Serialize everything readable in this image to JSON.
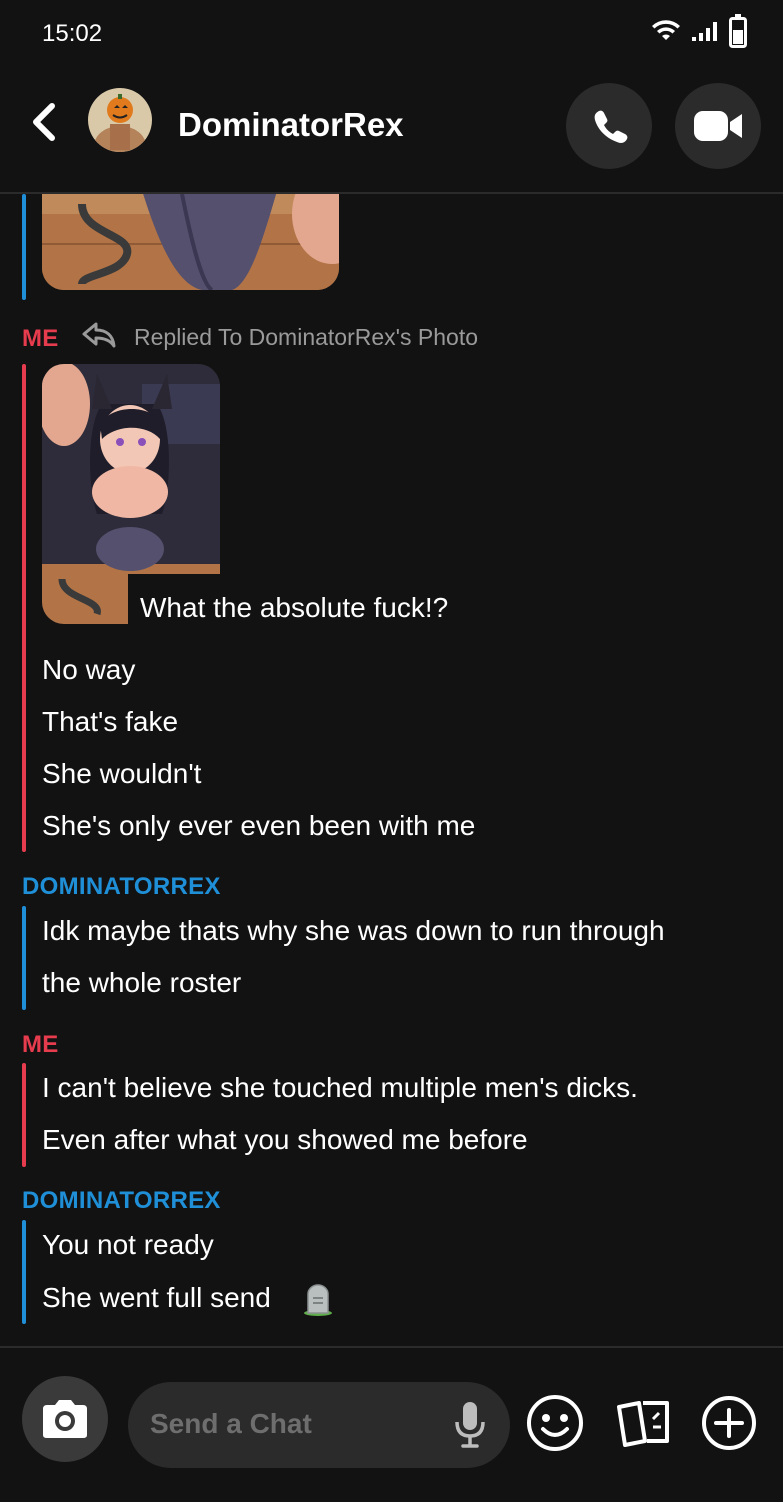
{
  "status_bar": {
    "time": "15:02"
  },
  "header": {
    "contact_name": "DominatorRex"
  },
  "messages": {
    "me_label_1": "ME",
    "reply_note": "Replied To DominatorRex's Photo",
    "caption": "What the absolute fuck!?",
    "me_1": "No way",
    "me_2": "That's fake",
    "me_3": "She wouldn't",
    "me_4": "She's only ever even been with me",
    "rex_label_1": "DOMINATORREX",
    "rex_1a": "Idk maybe thats why she was down to run through",
    "rex_1b": "the whole roster",
    "me_label_2": "ME",
    "me_5": "I can't believe she touched multiple men's dicks.",
    "me_6": "Even after what you showed me before",
    "rex_label_2": "DOMINATORREX",
    "rex_2": "You not ready",
    "rex_3": "She went full send"
  },
  "composer": {
    "placeholder": "Send a Chat"
  },
  "icons": {
    "back": "chevron-left-icon",
    "call": "phone-icon",
    "video": "video-camera-icon",
    "reply": "reply-arrow-icon",
    "camera": "camera-icon",
    "mic": "microphone-icon",
    "emoji": "smiley-icon",
    "cards": "cards-icon",
    "add": "plus-circle-icon",
    "tombstone": "tombstone-emoji"
  },
  "colors": {
    "me": "#e63c4e",
    "other": "#1f8fd8",
    "background": "#121212"
  }
}
